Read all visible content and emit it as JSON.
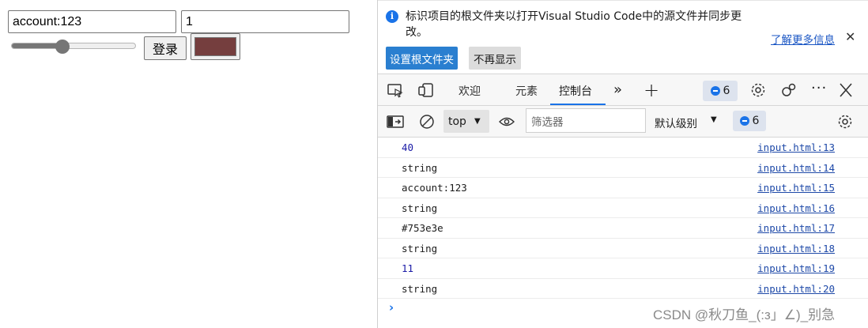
{
  "page": {
    "account_value": "account:123",
    "number_value": "1",
    "range_value_percent": 41,
    "login_label": "登录",
    "color_value": "#753e3e"
  },
  "devtools": {
    "infobar": {
      "message": "标识项目的根文件夹以打开Visual Studio Code中的源文件并同步更改。",
      "learn_more": "了解更多信息",
      "set_root_label": "设置根文件夹",
      "dont_show_label": "不再显示"
    },
    "tabs": [
      {
        "label": "欢迎"
      },
      {
        "label": "元素"
      },
      {
        "label": "控制台"
      }
    ],
    "message_count": "6",
    "toolbar": {
      "context": "top",
      "filter_placeholder": "筛选器",
      "level_label": "默认级别",
      "message_count": "6"
    },
    "console": [
      {
        "message": "40",
        "type": "number",
        "source": "input.html:13"
      },
      {
        "message": "string",
        "type": "string",
        "source": "input.html:14"
      },
      {
        "message": "account:123",
        "type": "string",
        "source": "input.html:15"
      },
      {
        "message": "string",
        "type": "string",
        "source": "input.html:16"
      },
      {
        "message": "#753e3e",
        "type": "string",
        "source": "input.html:17"
      },
      {
        "message": "string",
        "type": "string",
        "source": "input.html:18"
      },
      {
        "message": "11",
        "type": "number",
        "source": "input.html:19"
      },
      {
        "message": "string",
        "type": "string",
        "source": "input.html:20"
      }
    ]
  },
  "watermark": "CSDN @秋刀鱼_(:з」∠)_别急",
  "colors": {
    "accent": "#1a73e8",
    "number_log": "#1a1aa6",
    "swatch": "#753e3e"
  }
}
